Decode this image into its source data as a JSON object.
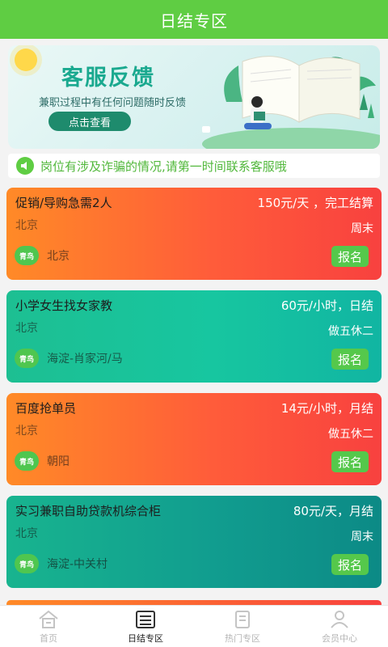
{
  "header": {
    "title": "日结专区"
  },
  "banner": {
    "title": "客服反馈",
    "subtitle": "兼职过程中有任何问题随时反馈",
    "button_label": "点击查看"
  },
  "notice": {
    "text": "岗位有涉及诈骗的情况,请第一时间联系客服哦"
  },
  "jobs": [
    {
      "title": "促销/导购急需2人",
      "salary": "150元/天 ，完工结算",
      "city": "北京",
      "schedule": "周末",
      "logo": "青鸟",
      "location": "北京",
      "apply_label": "报名"
    },
    {
      "title": "小学女生找女家教",
      "salary": "60元/小时，日结",
      "city": "北京",
      "schedule": "做五休二",
      "logo": "青鸟",
      "location": "海淀-肖家河/马",
      "apply_label": "报名"
    },
    {
      "title": "百度抢单员",
      "salary": "14元/小时，月结",
      "city": "北京",
      "schedule": "做五休二",
      "logo": "青鸟",
      "location": "朝阳",
      "apply_label": "报名"
    },
    {
      "title": "实习兼职自助贷款机综合柜",
      "salary": "80元/天，月结",
      "city": "北京",
      "schedule": "周末",
      "logo": "青鸟",
      "location": "海淀-中关村",
      "apply_label": "报名"
    }
  ],
  "tabs": [
    {
      "label": "首页",
      "icon": "home-icon"
    },
    {
      "label": "日结专区",
      "icon": "list-icon",
      "active": true
    },
    {
      "label": "热门专区",
      "icon": "document-icon"
    },
    {
      "label": "会员中心",
      "icon": "user-icon"
    }
  ],
  "colors": {
    "primary": "#5fcd43",
    "orange_card": "#ff6a30",
    "green_card": "#17c6a0",
    "teal_card": "#119d8f"
  }
}
